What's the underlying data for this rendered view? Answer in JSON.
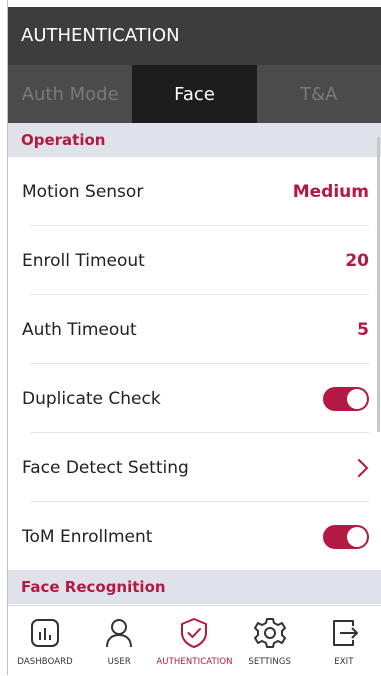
{
  "header": {
    "title": "AUTHENTICATION"
  },
  "tabs": [
    {
      "label": "Auth Mode",
      "active": false
    },
    {
      "label": "Face",
      "active": true
    },
    {
      "label": "T&A",
      "active": false
    }
  ],
  "sections": {
    "operation": "Operation",
    "face_recognition": "Face Recognition"
  },
  "rows": {
    "motion_sensor": {
      "label": "Motion Sensor",
      "value": "Medium"
    },
    "enroll_timeout": {
      "label": "Enroll Timeout",
      "value": "20"
    },
    "auth_timeout": {
      "label": "Auth Timeout",
      "value": "5"
    },
    "duplicate_check": {
      "label": "Duplicate Check",
      "enabled": true
    },
    "face_detect_setting": {
      "label": "Face Detect Setting"
    },
    "tom_enrollment": {
      "label": "ToM Enrollment",
      "enabled": true
    }
  },
  "nav": [
    {
      "label": "DASHBOARD",
      "icon": "dashboard-icon",
      "active": false
    },
    {
      "label": "USER",
      "icon": "user-icon",
      "active": false
    },
    {
      "label": "AUTHENTICATION",
      "icon": "shield-check-icon",
      "active": true
    },
    {
      "label": "SETTINGS",
      "icon": "gear-icon",
      "active": false
    },
    {
      "label": "EXIT",
      "icon": "exit-icon",
      "active": false
    }
  ],
  "colors": {
    "accent": "#b31942",
    "header_bg": "#3d3d3d",
    "active_tab_bg": "#1d1d1d",
    "section_bg": "#e0e2ea"
  }
}
